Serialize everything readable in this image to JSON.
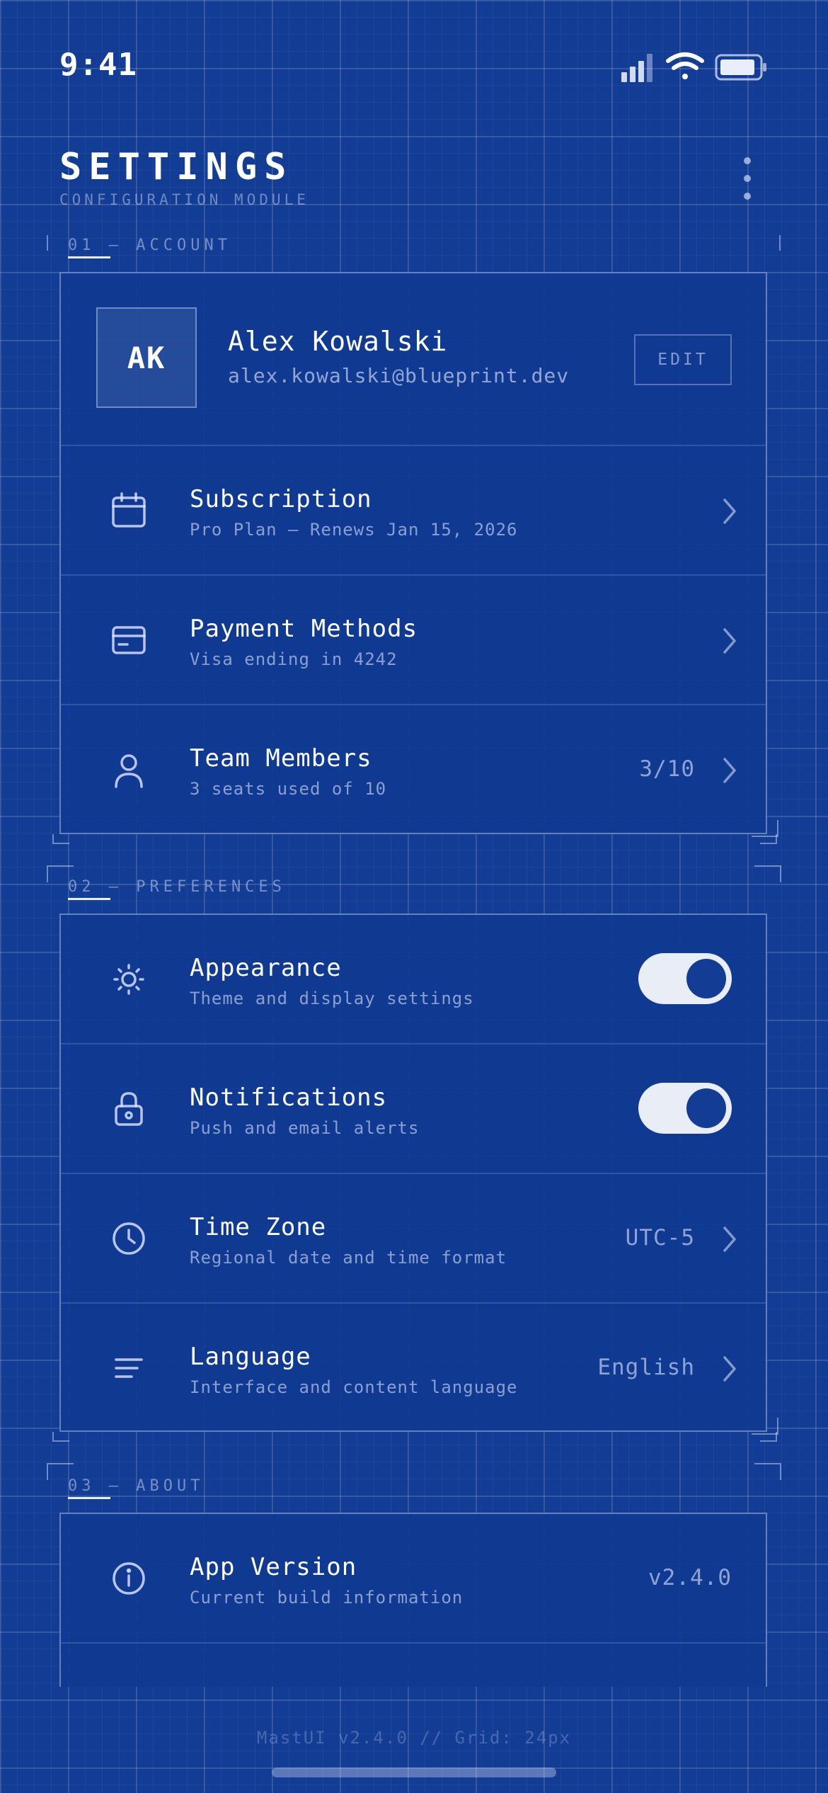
{
  "status_bar": {
    "time": "9:41"
  },
  "header": {
    "title": "SETTINGS",
    "subtitle": "CONFIGURATION MODULE"
  },
  "sections": {
    "account": {
      "label": "01 — ACCOUNT",
      "profile": {
        "initials": "AK",
        "name": "Alex Kowalski",
        "email": "alex.kowalski@blueprint.dev",
        "edit_label": "EDIT"
      },
      "items": [
        {
          "title": "Subscription",
          "subtitle": "Pro Plan — Renews Jan 15, 2026",
          "icon": "calendar-icon"
        },
        {
          "title": "Payment Methods",
          "subtitle": "Visa ending in 4242",
          "icon": "credit-card-icon"
        },
        {
          "title": "Team Members",
          "subtitle": "3 seats used of 10",
          "value": "3/10",
          "icon": "user-icon"
        }
      ]
    },
    "preferences": {
      "label": "02 — PREFERENCES",
      "items": [
        {
          "title": "Appearance",
          "subtitle": "Theme and display settings",
          "toggle": true,
          "icon": "sun-icon"
        },
        {
          "title": "Notifications",
          "subtitle": "Push and email alerts",
          "toggle": true,
          "icon": "lock-icon"
        },
        {
          "title": "Time Zone",
          "subtitle": "Regional date and time format",
          "value": "UTC-5",
          "icon": "clock-icon"
        },
        {
          "title": "Language",
          "subtitle": "Interface and content language",
          "value": "English",
          "icon": "lines-icon"
        }
      ]
    },
    "about": {
      "label": "03 — ABOUT",
      "items": [
        {
          "title": "App Version",
          "subtitle": "Current build information",
          "value": "v2.4.0",
          "icon": "info-icon"
        }
      ]
    }
  },
  "footer": {
    "text": "MastUI v2.4.0 // Grid: 24px"
  },
  "colors": {
    "background": "#133d95",
    "card": "#103a91",
    "toggle_on": "#e8edf6",
    "accent": "#ffffff"
  }
}
